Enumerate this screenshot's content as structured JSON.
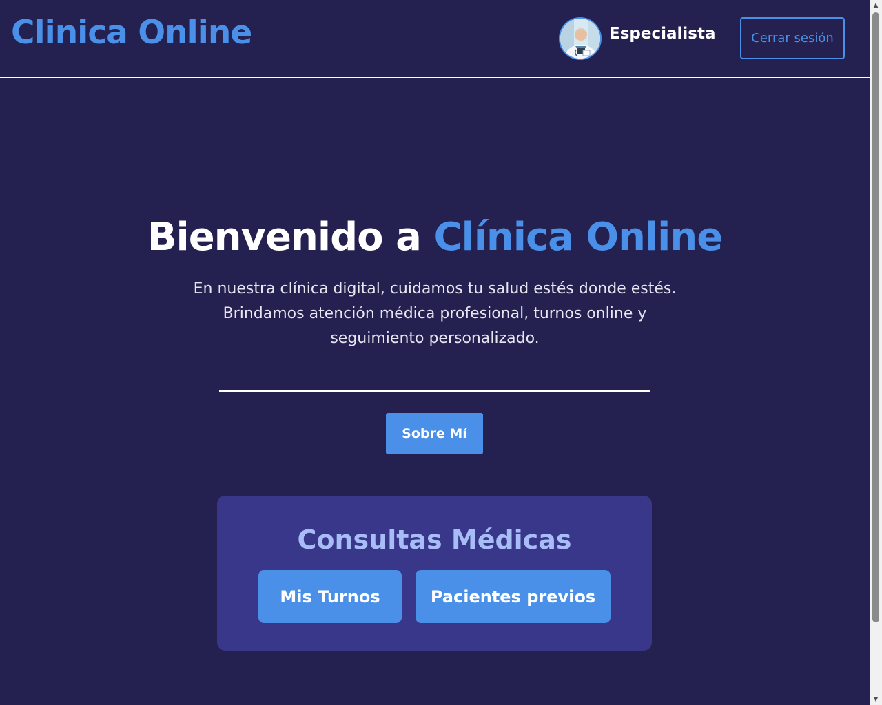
{
  "header": {
    "brand": "Clinica Online",
    "role": "Especialista",
    "logout_label": "Cerrar sesión"
  },
  "hero": {
    "title_prefix": "Bienvenido a ",
    "title_accent": "Clínica Online",
    "description": "En nuestra clínica digital, cuidamos tu salud estés donde estés. Brindamos atención médica profesional, turnos online y seguimiento personalizado.",
    "about_button": "Sobre Mí"
  },
  "card": {
    "title": "Consultas Médicas",
    "buttons": {
      "turnos": "Mis Turnos",
      "pacientes": "Pacientes previos"
    }
  },
  "colors": {
    "background": "#24204f",
    "accent": "#4a8fe8",
    "card": "#383789",
    "card_title": "#a8bdf7"
  }
}
